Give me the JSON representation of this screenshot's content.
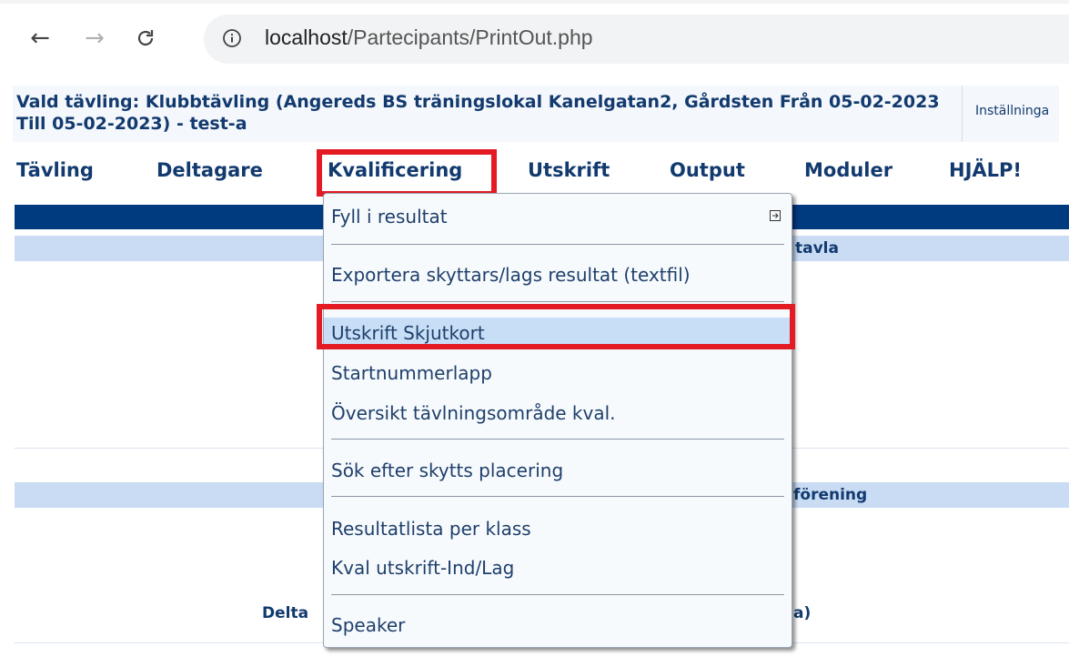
{
  "browser": {
    "url_host": "localhost",
    "url_path": "/Partecipants/PrintOut.php"
  },
  "header": {
    "title": "Vald tävling: Klubbtävling (Angereds BS träningslokal Kanelgatan2, Gårdsten Från 05-02-2023 Till 05-02-2023) - test-a",
    "settings": "Inställninga"
  },
  "menubar": {
    "items": [
      "Tävling",
      "Deltagare",
      "Kvalificering",
      "Utskrift",
      "Output",
      "Moduler",
      "HJÄLP!"
    ]
  },
  "background": {
    "row1_text": "tavla",
    "row2_text": "förening",
    "row3_left": "Delta",
    "row3_right": "a)"
  },
  "dropdown": {
    "items": [
      {
        "label": "Fyll i resultat",
        "submenu": true
      },
      {
        "label": "Exportera skyttars/lags resultat (textfil)"
      },
      {
        "label": "Utskrift Skjutkort",
        "highlighted": true
      },
      {
        "label": "Startnummerlapp"
      },
      {
        "label": "Översikt tävlningsområde kval."
      },
      {
        "label": "Sök efter skytts placering"
      },
      {
        "label": "Resultatlista per klass"
      },
      {
        "label": "Kval utskrift-Ind/Lag"
      },
      {
        "label": "Speaker"
      }
    ]
  },
  "colors": {
    "annotation_red": "#e31b23",
    "nav_blue": "#123a6f",
    "header_bar": "#003a7f"
  }
}
